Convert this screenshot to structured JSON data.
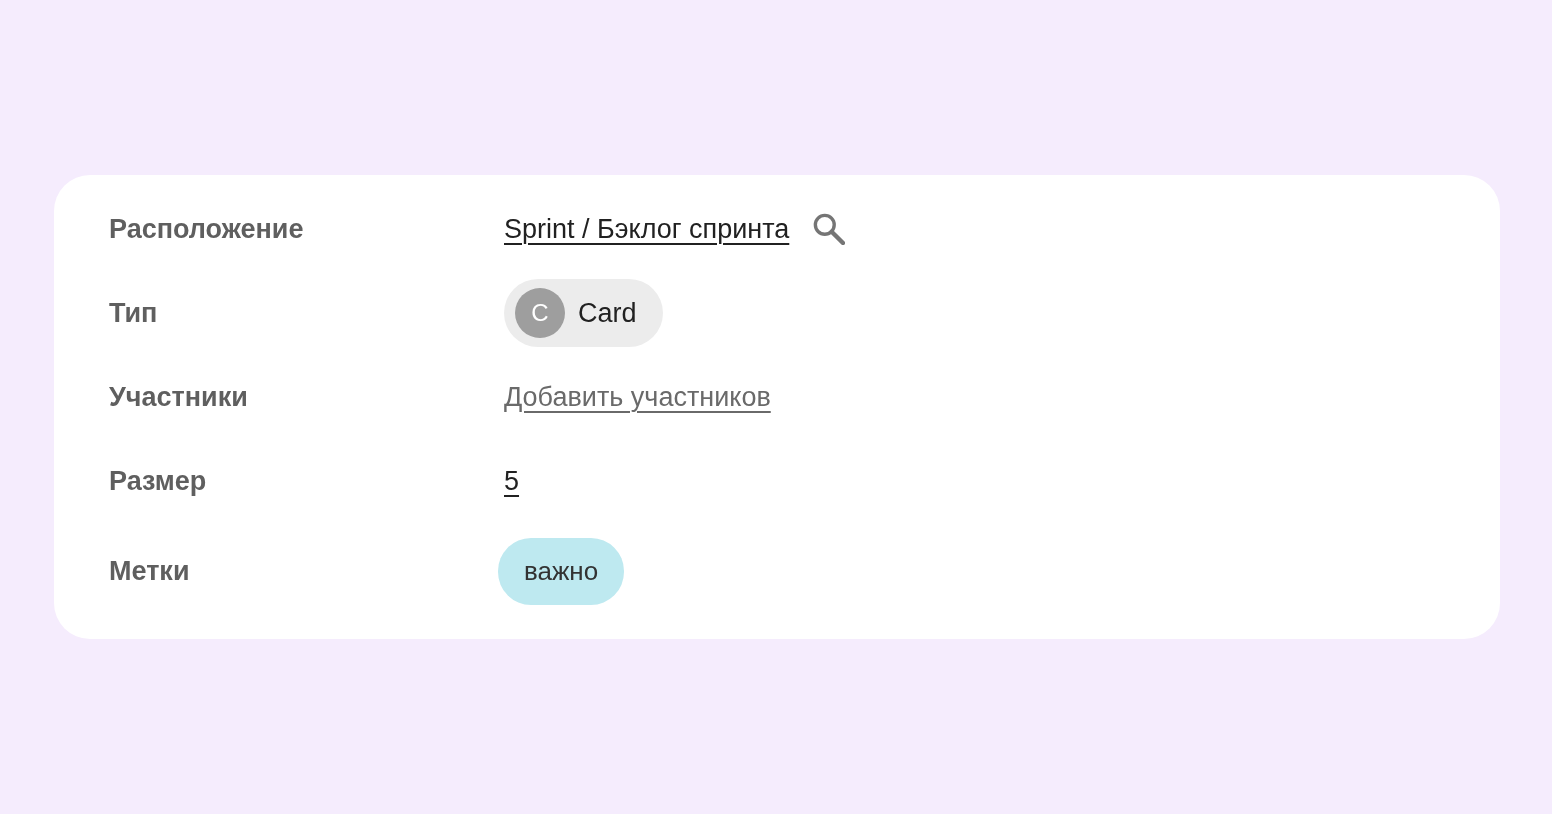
{
  "fields": [
    {
      "kind": "path",
      "label": "Расположение",
      "value": "Sprint / Бэклог спринта"
    },
    {
      "kind": "type",
      "label": "Тип",
      "avatar": "C",
      "value": "Card"
    },
    {
      "kind": "action",
      "label": "Участники",
      "value": "Добавить участников"
    },
    {
      "kind": "number",
      "label": "Размер",
      "value": "5"
    },
    {
      "kind": "tags",
      "label": "Метки",
      "tags": [
        {
          "text": "важно",
          "color": "#bee9f0"
        }
      ]
    }
  ]
}
